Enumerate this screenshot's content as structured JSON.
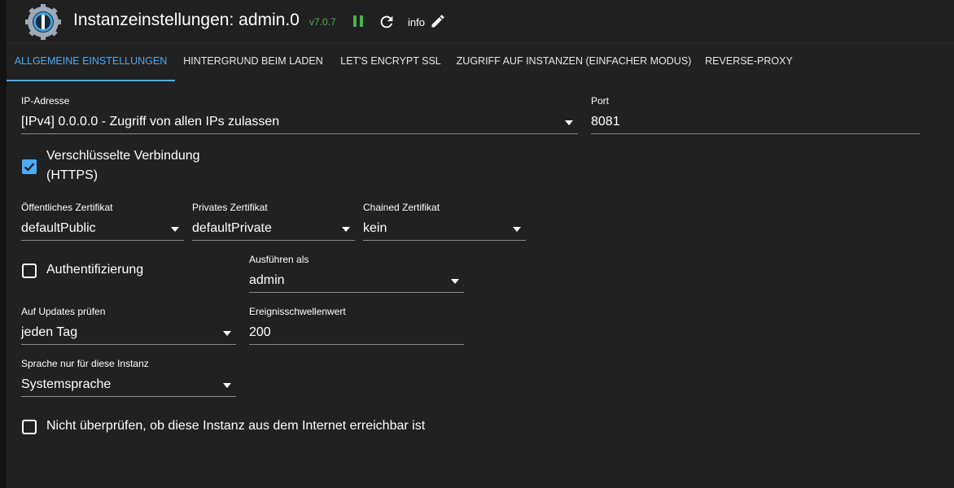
{
  "header": {
    "title": "Instanzeinstellungen: admin.0",
    "version": "v7.0.7",
    "info_label": "info"
  },
  "tabs": [
    {
      "label": "Allgemeine Einstellungen",
      "active": true
    },
    {
      "label": "Hintergrund beim Laden"
    },
    {
      "label": "Let's Encrypt SSL"
    },
    {
      "label": "Zugriff auf Instanzen (einfacher Modus)"
    },
    {
      "label": "Reverse-Proxy"
    }
  ],
  "form": {
    "ip_address": {
      "label": "IP-Adresse",
      "value": "[IPv4] 0.0.0.0 - Zugriff von allen IPs zulassen"
    },
    "port": {
      "label": "Port",
      "value": "8081"
    },
    "https": {
      "label_line1": "Verschlüsselte Verbindung",
      "label_line2": "(HTTPS)",
      "checked": true
    },
    "public_cert": {
      "label": "Öffentliches Zertifikat",
      "value": "defaultPublic"
    },
    "private_cert": {
      "label": "Privates Zertifikat",
      "value": "defaultPrivate"
    },
    "chained_cert": {
      "label": "Chained Zertifikat",
      "value": "kein"
    },
    "auth": {
      "label": "Authentifizierung",
      "checked": false
    },
    "run_as": {
      "label": "Ausführen als",
      "value": "admin"
    },
    "updates": {
      "label": "Auf Updates prüfen",
      "value": "jeden Tag"
    },
    "threshold": {
      "label": "Ereignisschwellenwert",
      "value": "200"
    },
    "language": {
      "label": "Sprache nur für diese Instanz",
      "value": "Systemsprache"
    },
    "no_reachability": {
      "label": "Nicht überprüfen, ob diese Instanz aus dem Internet erreichbar ist",
      "checked": false
    }
  },
  "colors": {
    "accent": "#4dabf5",
    "version": "#4caf50",
    "background": "#212121"
  },
  "icons": [
    "iobroker-logo-icon",
    "pause-icon",
    "reload-icon",
    "edit-icon",
    "dropdown-arrow-icon",
    "checkbox-checked-icon",
    "checkbox-unchecked-icon"
  ]
}
